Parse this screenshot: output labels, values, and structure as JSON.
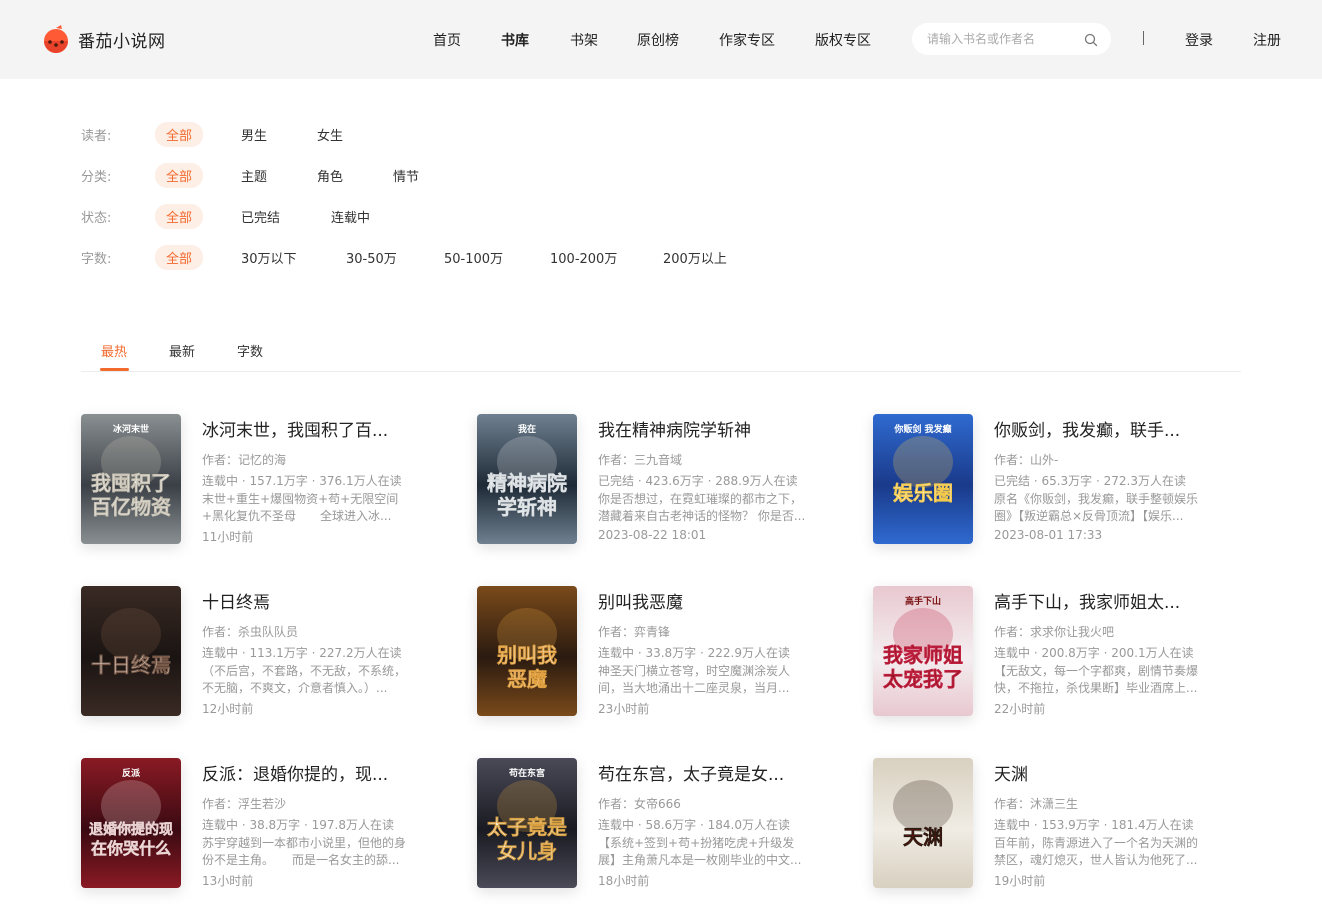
{
  "header": {
    "site_name": "番茄小说网",
    "nav": [
      "首页",
      "书库",
      "书架",
      "原创榜",
      "作家专区",
      "版权专区"
    ],
    "active_nav": "书库",
    "search_placeholder": "请输入书名或作者名",
    "login": "登录",
    "register": "注册"
  },
  "filters": [
    {
      "label": "读者:",
      "options": [
        "全部",
        "男生",
        "女生"
      ]
    },
    {
      "label": "分类:",
      "options": [
        "全部",
        "主题",
        "角色",
        "情节"
      ]
    },
    {
      "label": "状态:",
      "options": [
        "全部",
        "已完结",
        "连载中"
      ]
    },
    {
      "label": "字数:",
      "options": [
        "全部",
        "30万以下",
        "30-50万",
        "50-100万",
        "100-200万",
        "200万以上"
      ]
    }
  ],
  "tabs": [
    "最热",
    "最新",
    "字数"
  ],
  "active_tab": "最热",
  "books": [
    {
      "title": "冰河末世，我囤积了百...",
      "author": "作者：记忆的海",
      "stats": "连载中 · 157.1万字 · 376.1万人在读",
      "desc": "末世+重生+爆囤物资+苟+无限空间+黑化复仇不圣母　　全球进入冰...",
      "time": "11小时前",
      "cover_text": "我囤积了百亿物资",
      "cover_top": "冰河末世",
      "cover_colors": [
        "#3a4046",
        "#8a8f92",
        "#c8c2b4"
      ]
    },
    {
      "title": "我在精神病院学斩神",
      "author": "作者：三九音域",
      "stats": "已完结 · 423.6万字 · 288.9万人在读",
      "desc": "你是否想过，在霓虹璀璨的都市之下，潜藏着来自古老神话的怪物？ 你是否...",
      "time": "2023-08-22 18:01",
      "cover_text": "精神病院学斩神",
      "cover_top": "我在",
      "cover_colors": [
        "#1e2a36",
        "#6f8090",
        "#d8dde0"
      ]
    },
    {
      "title": "你贩剑，我发癫，联手...",
      "author": "作者：山外-",
      "stats": "已完结 · 65.3万字 · 272.3万人在读",
      "desc": "原名《你贩剑，我发癫，联手整顿娱乐圈》【叛逆霸总×反骨顶流】【娱乐...",
      "time": "2023-08-01 17:33",
      "cover_text": "娱乐圈",
      "cover_top": "你贩剑 我发癫",
      "cover_colors": [
        "#1a3a8a",
        "#2f6ad0",
        "#f2c84a"
      ]
    },
    {
      "title": "十日终焉",
      "author": "作者：杀虫队队员",
      "stats": "连载中 · 113.1万字 · 227.2万人在读",
      "desc": "（不后宫，不套路，不无敌，不系统，不无脑，不爽文，介意者慎入。）...",
      "time": "12小时前",
      "cover_text": "十日终焉",
      "cover_top": "",
      "cover_colors": [
        "#1a1412",
        "#3a2a24",
        "#7a5a48"
      ]
    },
    {
      "title": "别叫我恶魔",
      "author": "作者：弈青锋",
      "stats": "连载中 · 33.8万字 · 222.9万人在读",
      "desc": "神圣天门横立苍穹，时空魔渊涂炭人间，当大地涌出十二座灵泉，当月...",
      "time": "23小时前",
      "cover_text": "别叫我恶魔",
      "cover_top": "",
      "cover_colors": [
        "#2a1a10",
        "#7a4a1a",
        "#e0a040"
      ]
    },
    {
      "title": "高手下山，我家师姐太...",
      "author": "作者：求求你让我火吧",
      "stats": "连载中 · 200.8万字 · 200.1万人在读",
      "desc": "【无敌文，每一个字都爽，剧情节奏爆快，不拖拉，杀伐果断】毕业酒席上...",
      "time": "22小时前",
      "cover_text": "我家师姐太宠我了",
      "cover_top": "高手下山",
      "cover_colors": [
        "#f4eef0",
        "#e8c8d0",
        "#c02040"
      ]
    },
    {
      "title": "反派：退婚你提的，现...",
      "author": "作者：浮生若沙",
      "stats": "连载中 · 38.8万字 · 197.8万人在读",
      "desc": "苏宇穿越到一本都市小说里，但他的身份不是主角。　　而是一名女主的舔...",
      "time": "13小时前",
      "cover_text": "退婚你提的现在你哭什么",
      "cover_top": "反派",
      "cover_colors": [
        "#3a0a12",
        "#8a1a24",
        "#e8d0d0"
      ]
    },
    {
      "title": "苟在东宫，太子竟是女...",
      "author": "作者：女帝666",
      "stats": "连载中 · 58.6万字 · 184.0万人在读",
      "desc": "【系统+签到+苟+扮猪吃虎+升级发展】主角萧凡本是一枚刚毕业的中文...",
      "time": "18小时前",
      "cover_text": "太子竟是女儿身",
      "cover_top": "苟在东宫",
      "cover_colors": [
        "#1a1a22",
        "#4a4a58",
        "#d8a040"
      ]
    },
    {
      "title": "天渊",
      "author": "作者：沐潇三生",
      "stats": "连载中 · 153.9万字 · 181.4万人在读",
      "desc": "百年前，陈青源进入了一个名为天渊的禁区，魂灯熄灭，世人皆认为他死了...",
      "time": "19小时前",
      "cover_text": "天渊",
      "cover_top": "",
      "cover_colors": [
        "#f0ece4",
        "#d8d0c0",
        "#2a1a10"
      ]
    }
  ]
}
